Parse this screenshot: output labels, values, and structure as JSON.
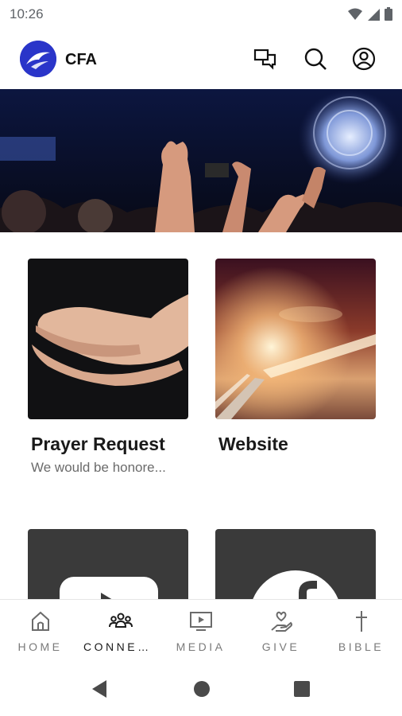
{
  "status_bar": {
    "time": "10:26"
  },
  "header": {
    "app_name": "CFA"
  },
  "cards": [
    {
      "title": "Prayer Request",
      "subtitle": "We would be honore..."
    },
    {
      "title": "Website",
      "subtitle": ""
    }
  ],
  "bottom_nav": [
    {
      "label": "HOME",
      "icon": "home-icon",
      "active": false
    },
    {
      "label": "CONNEC…",
      "icon": "people-icon",
      "active": true
    },
    {
      "label": "MEDIA",
      "icon": "tv-icon",
      "active": false
    },
    {
      "label": "GIVE",
      "icon": "give-icon",
      "active": false
    },
    {
      "label": "BIBLE",
      "icon": "cross-icon",
      "active": false
    }
  ],
  "colors": {
    "brand": "#2a35c9",
    "card_dark": "#3a3a3a",
    "active_nav": "#1a1a1a",
    "inactive_nav": "#7a7a7a"
  }
}
